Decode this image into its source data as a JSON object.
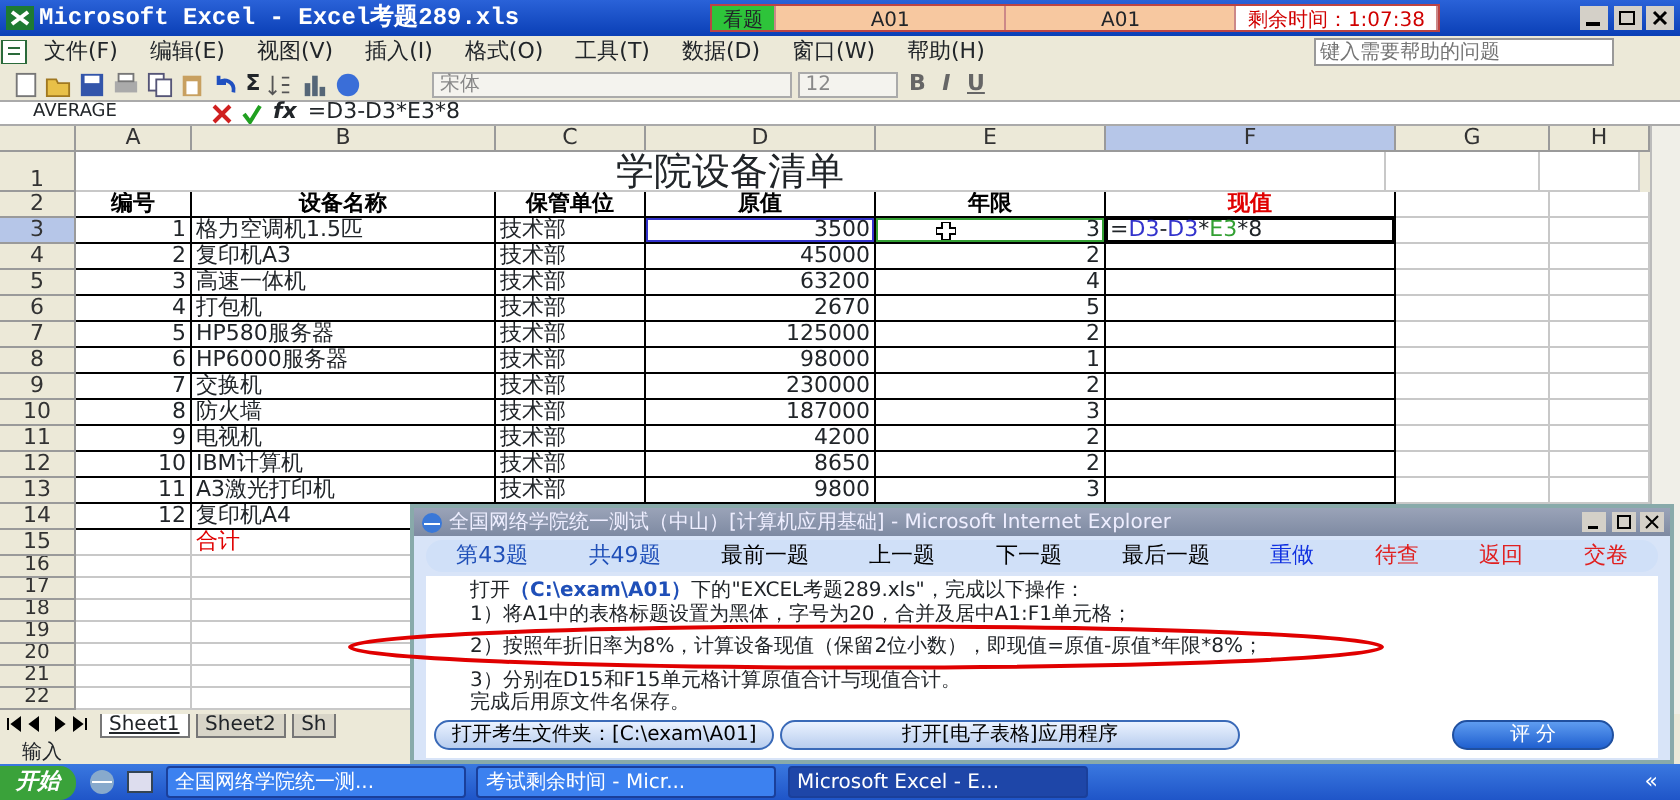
{
  "window": {
    "title": "Microsoft Excel - Excel考题289.xls"
  },
  "timer": {
    "tab": "看题",
    "fields": [
      "A01",
      "A01"
    ],
    "remaining": "剩余时间：1:07:38"
  },
  "menu": [
    "文件(F)",
    "编辑(E)",
    "视图(V)",
    "插入(I)",
    "格式(O)",
    "工具(T)",
    "数据(D)",
    "窗口(W)",
    "帮助(H)"
  ],
  "help": {
    "placeholder": "键入需要帮助的问题"
  },
  "toolbar": {
    "sum": "Σ",
    "font": "宋体",
    "size": "12",
    "styles": [
      "B",
      "I",
      "U"
    ]
  },
  "formula_bar": {
    "name_box": "AVERAGE",
    "fx": "fx",
    "formula": "=D3-D3*E3*8"
  },
  "sheet": {
    "columns": [
      {
        "label": "A",
        "selected": false
      },
      {
        "label": "B",
        "selected": false
      },
      {
        "label": "C",
        "selected": false
      },
      {
        "label": "D",
        "selected": false
      },
      {
        "label": "E",
        "selected": false
      },
      {
        "label": "F",
        "selected": true
      },
      {
        "label": "G",
        "selected": false
      },
      {
        "label": "H",
        "selected": false
      }
    ],
    "title_row": {
      "number": "1",
      "title": "学院设备清单"
    },
    "header_row": {
      "number": "2",
      "cells": [
        {
          "text": "编号",
          "emphasis": false
        },
        {
          "text": "设备名称",
          "emphasis": false
        },
        {
          "text": "保管单位",
          "emphasis": false
        },
        {
          "text": "原值",
          "emphasis": false
        },
        {
          "text": "年限",
          "emphasis": false
        },
        {
          "text": "现值",
          "emphasis": true
        }
      ]
    },
    "rows": [
      {
        "number": "3",
        "selected": true,
        "no": "1",
        "name": "格力空调机1.5匹",
        "dept": "技术部",
        "value": "3500",
        "years": "3",
        "editing": [
          {
            "text": "="
          },
          {
            "text": "D3",
            "color": "#3333cc"
          },
          {
            "text": "-"
          },
          {
            "text": "D3",
            "color": "#3333cc"
          },
          {
            "text": "*"
          },
          {
            "text": "E3",
            "color": "#33a033"
          },
          {
            "text": "*8"
          }
        ]
      },
      {
        "number": "4",
        "selected": false,
        "no": "2",
        "name": "复印机A3",
        "dept": "技术部",
        "value": "45000",
        "years": "2"
      },
      {
        "number": "5",
        "selected": false,
        "no": "3",
        "name": "高速一体机",
        "dept": "技术部",
        "value": "63200",
        "years": "4"
      },
      {
        "number": "6",
        "selected": false,
        "no": "4",
        "name": "打包机",
        "dept": "技术部",
        "value": "2670",
        "years": "5"
      },
      {
        "number": "7",
        "selected": false,
        "no": "5",
        "name": "HP580服务器",
        "dept": "技术部",
        "value": "125000",
        "years": "2"
      },
      {
        "number": "8",
        "selected": false,
        "no": "6",
        "name": "HP6000服务器",
        "dept": "技术部",
        "value": "98000",
        "years": "1"
      },
      {
        "number": "9",
        "selected": false,
        "no": "7",
        "name": "交换机",
        "dept": "技术部",
        "value": "230000",
        "years": "2"
      },
      {
        "number": "10",
        "selected": false,
        "no": "8",
        "name": "防火墙",
        "dept": "技术部",
        "value": "187000",
        "years": "3"
      },
      {
        "number": "11",
        "selected": false,
        "no": "9",
        "name": "电视机",
        "dept": "技术部",
        "value": "4200",
        "years": "2"
      },
      {
        "number": "12",
        "selected": false,
        "no": "10",
        "name": "IBM计算机",
        "dept": "技术部",
        "value": "8650",
        "years": "2"
      },
      {
        "number": "13",
        "selected": false,
        "no": "11",
        "name": "A3激光打印机",
        "dept": "技术部",
        "value": "9800",
        "years": "3"
      },
      {
        "number": "14",
        "selected": false,
        "no": "12",
        "name": "复印机A4"
      }
    ],
    "total_row": {
      "number": "15",
      "label": "合计"
    },
    "empty_rows": [
      "16",
      "17",
      "18",
      "19",
      "20",
      "21",
      "22"
    ],
    "tabs": [
      {
        "label": "Sheet1",
        "selected": true
      },
      {
        "label": "Sheet2",
        "selected": false
      },
      {
        "label": "Sh",
        "selected": false
      }
    ]
  },
  "status_bar": "输入",
  "dialog": {
    "title": "全国网络学院统一测试（中山）[计算机应用基础] - Microsoft Internet Explorer",
    "nav": [
      {
        "text": "第43题",
        "color": "#1f4fb8"
      },
      {
        "text": "共49题",
        "color": "#1f4fb8"
      },
      {
        "text": "最前一题",
        "color": "#000000"
      },
      {
        "text": "上一题",
        "color": "#000000"
      },
      {
        "text": "下一题",
        "color": "#000000"
      },
      {
        "text": "最后一题",
        "color": "#000000"
      },
      {
        "text": "重做",
        "color": "#1030e0"
      },
      {
        "text": "待查",
        "color": "#e02020"
      },
      {
        "text": "返回",
        "color": "#e02020"
      },
      {
        "text": "交卷",
        "color": "#e02020"
      }
    ],
    "lines": [
      {
        "text": "打开**（C:\\exam\\A01）**下的\"EXCEL考题289.xls\"，完成以下操作：",
        "circled": false
      },
      {
        "text": "1）将A1中的表格标题设置为黑体，字号为20，合并及居中A1:F1单元格；",
        "circled": false
      },
      {
        "text": "2）按照年折旧率为8%，计算设备现值（保留2位小数），即现值=原值-原值*年限*8%；",
        "circled": true
      },
      {
        "text": "3）分别在D15和F15单元格计算原值合计与现值合计。",
        "circled": false
      },
      {
        "text": "完成后用原文件名保存。",
        "circled": false
      }
    ],
    "buttons": [
      "打开考生文件夹：[C:\\exam\\A01]",
      "打开[电子表格]应用程序"
    ],
    "score_button": "评 分"
  },
  "taskbar": {
    "start": "开始",
    "tasks": [
      {
        "label": "全国网络学院统一测...",
        "selected": false
      },
      {
        "label": "考试剩余时间 - Micr...",
        "selected": false
      },
      {
        "label": "Microsoft Excel - E...",
        "selected": true
      }
    ],
    "tray": "«"
  }
}
